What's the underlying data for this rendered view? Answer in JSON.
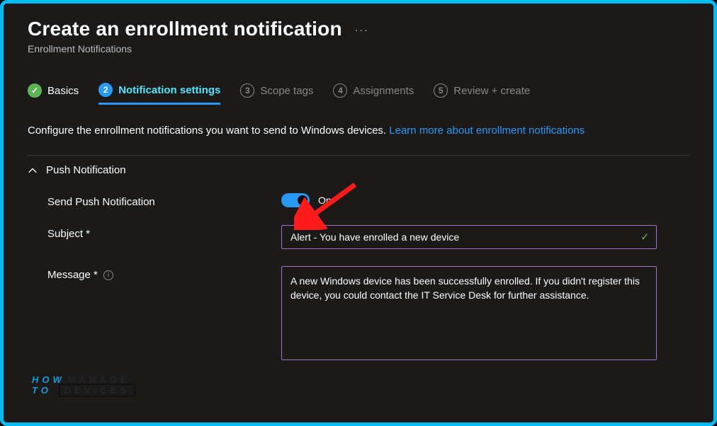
{
  "header": {
    "title": "Create an enrollment notification",
    "ellipsis": "···",
    "subtitle": "Enrollment Notifications"
  },
  "tabs": [
    {
      "num": "",
      "label": "Basics",
      "state": "completed"
    },
    {
      "num": "2",
      "label": "Notification settings",
      "state": "active"
    },
    {
      "num": "3",
      "label": "Scope tags",
      "state": "upcoming"
    },
    {
      "num": "4",
      "label": "Assignments",
      "state": "upcoming"
    },
    {
      "num": "5",
      "label": "Review + create",
      "state": "upcoming"
    }
  ],
  "description": {
    "text": "Configure the enrollment notifications you want to send to Windows devices. ",
    "link_text": "Learn more about enrollment notifications"
  },
  "section": {
    "title": "Push Notification",
    "expanded": true
  },
  "form": {
    "send_push": {
      "label": "Send Push Notification",
      "value": true,
      "value_label": "On"
    },
    "subject": {
      "label": "Subject *",
      "value": "Alert - You have enrolled a new device",
      "valid": true
    },
    "message": {
      "label": "Message *",
      "value": "A new Windows device has been successfully enrolled. If you didn't register this device, you could contact the IT Service Desk for further assistance."
    }
  },
  "watermark": {
    "how": "HOW",
    "manage": "MANAGE",
    "to": "TO",
    "devices": "DEVICES"
  },
  "colors": {
    "accent": "#2899f5",
    "outer_border": "#00bcf2",
    "input_border": "#a86ed4",
    "completed": "#5ab552"
  }
}
